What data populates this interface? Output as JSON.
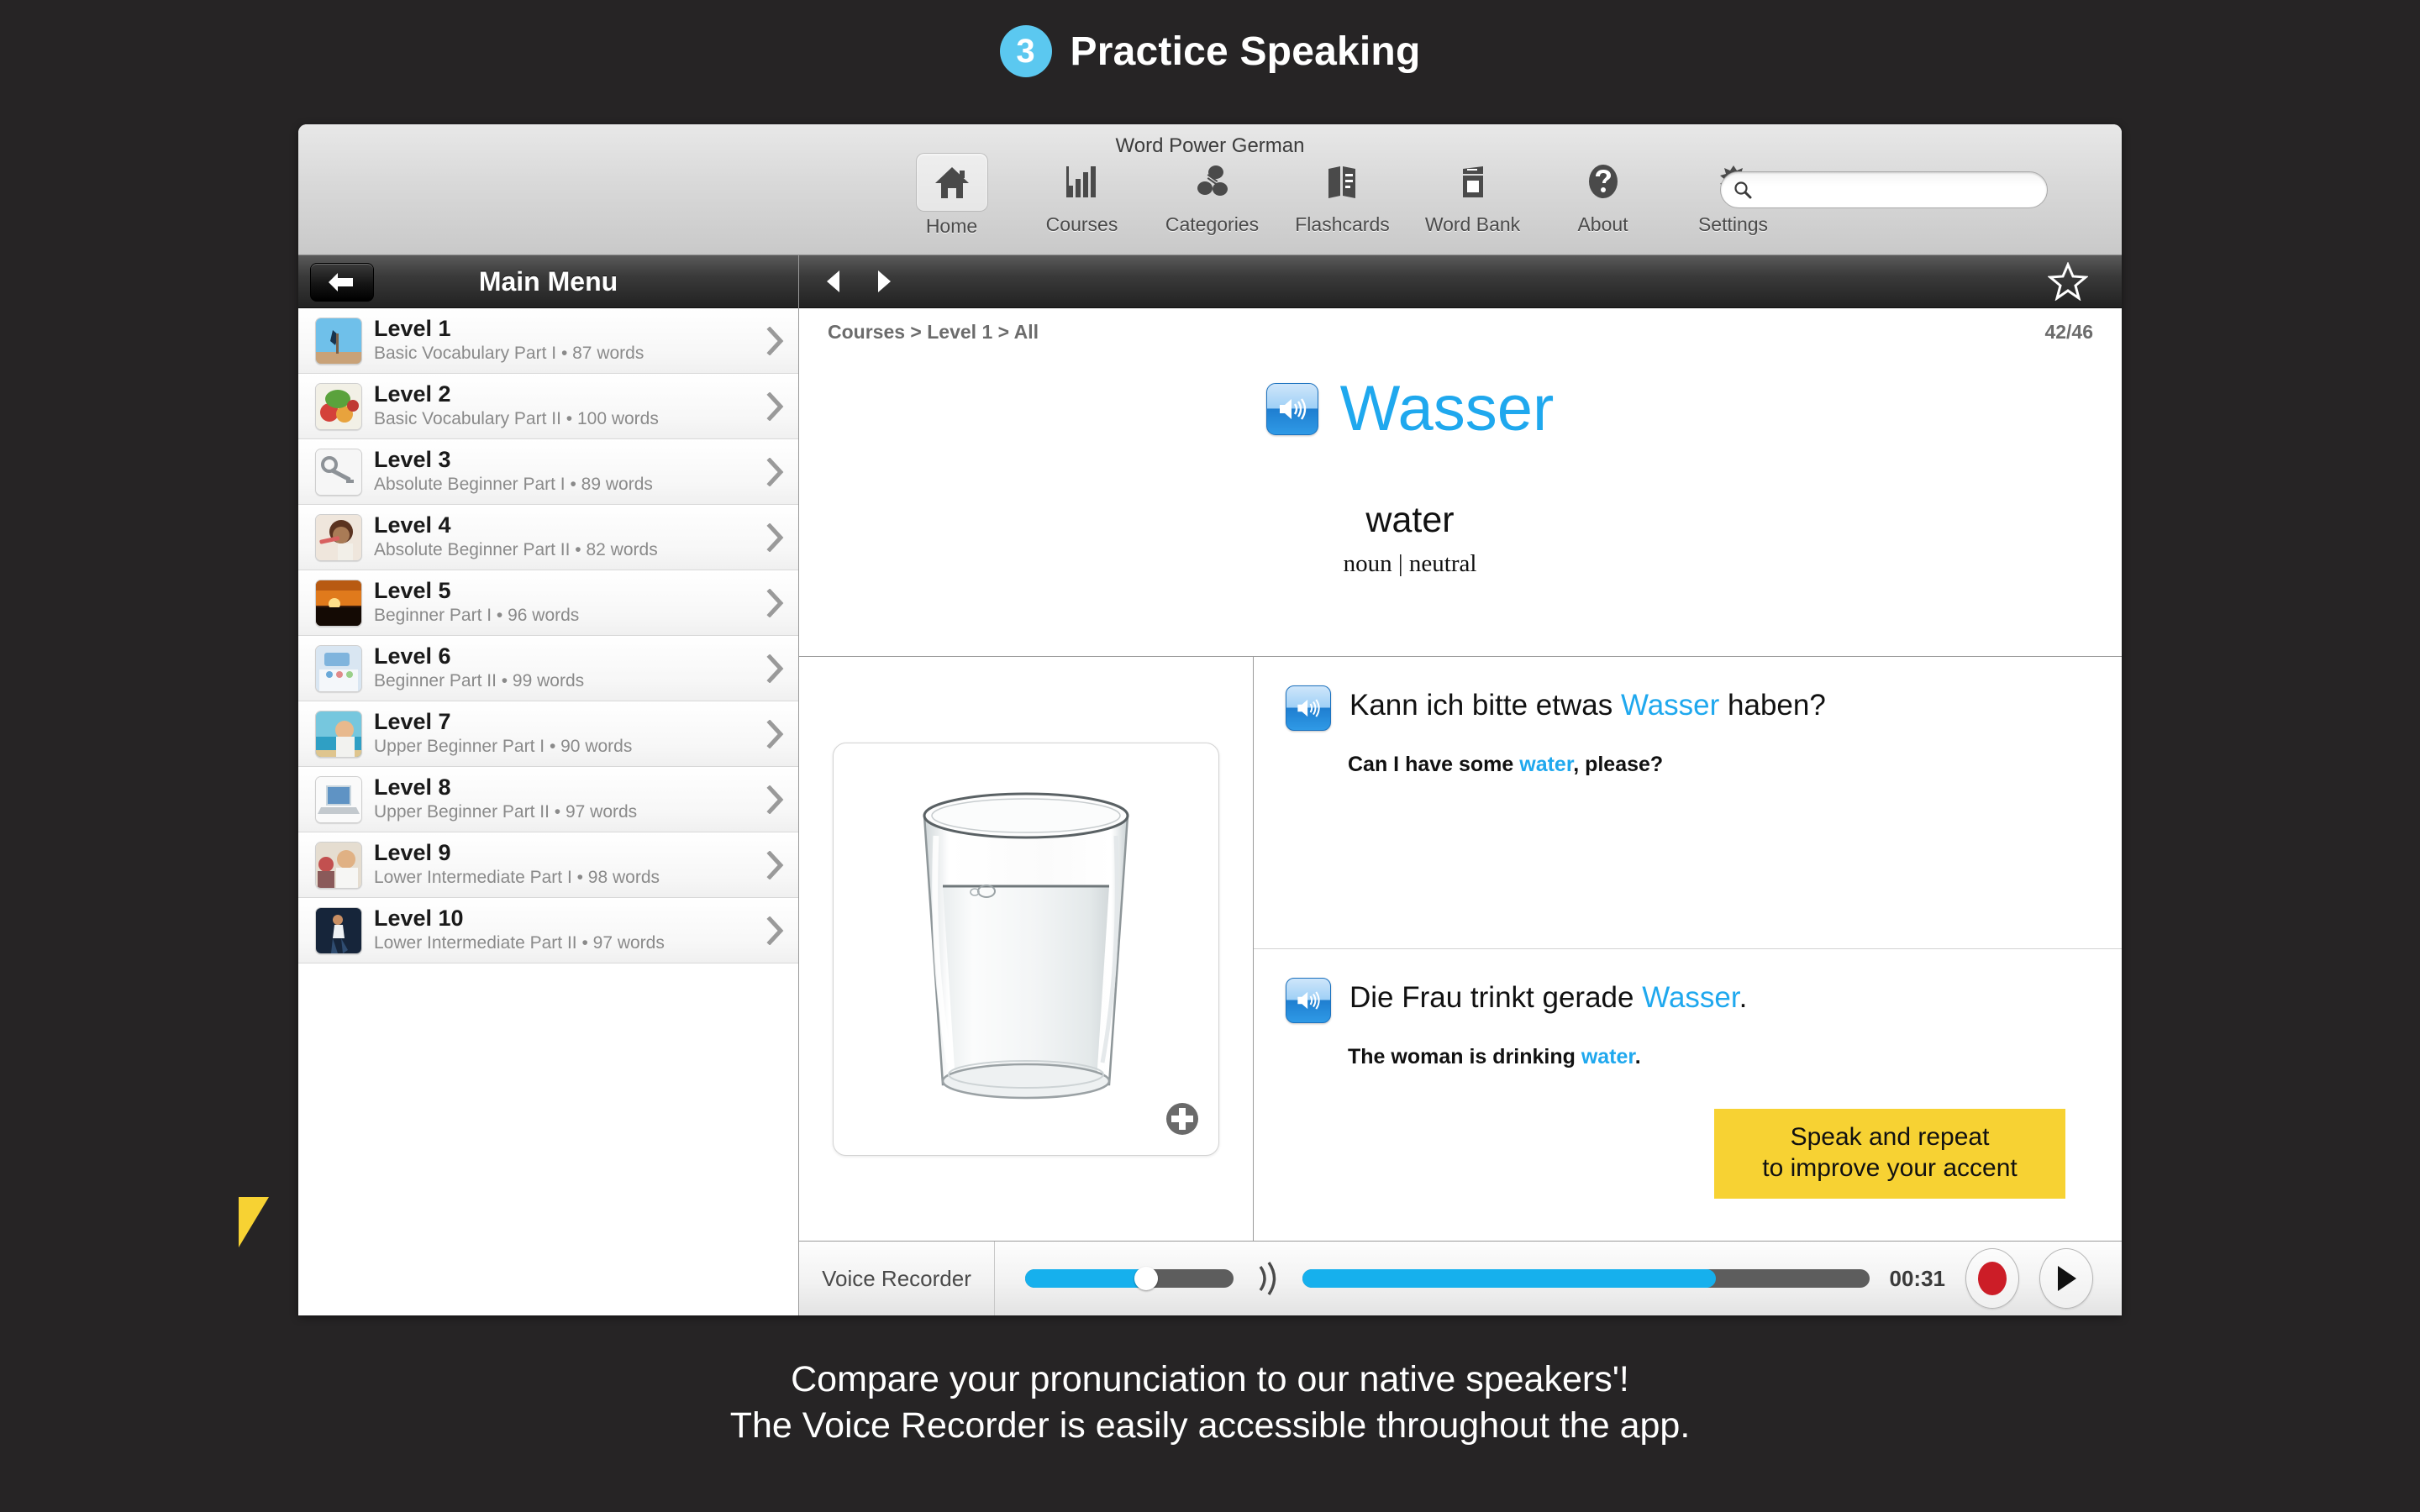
{
  "promo": {
    "step_number": "3",
    "title": "Practice Speaking",
    "caption_line1": "Compare your pronunciation to our native speakers'!",
    "caption_line2": "The Voice Recorder is easily accessible throughout the app.",
    "badge_color": "#5BC8F0"
  },
  "window": {
    "title": "Word Power German"
  },
  "toolbar": {
    "items": [
      {
        "label": "Home",
        "icon": "home-icon",
        "selected": true
      },
      {
        "label": "Courses",
        "icon": "bar-chart-icon",
        "selected": false
      },
      {
        "label": "Categories",
        "icon": "categories-icon",
        "selected": false
      },
      {
        "label": "Flashcards",
        "icon": "flashcards-icon",
        "selected": false
      },
      {
        "label": "Word Bank",
        "icon": "word-bank-icon",
        "selected": false
      },
      {
        "label": "About",
        "icon": "question-mark-icon",
        "selected": false
      },
      {
        "label": "Settings",
        "icon": "gear-icon",
        "selected": false
      }
    ],
    "search": {
      "value": "",
      "placeholder": ""
    }
  },
  "sidebar": {
    "header_title": "Main Menu",
    "back_button": "back-arrow-icon",
    "items": [
      {
        "name": "Level 1",
        "sub": "Basic Vocabulary Part I • 87 words"
      },
      {
        "name": "Level 2",
        "sub": "Basic Vocabulary Part II • 100 words"
      },
      {
        "name": "Level 3",
        "sub": "Absolute Beginner Part I • 89 words"
      },
      {
        "name": "Level 4",
        "sub": "Absolute Beginner Part II • 82 words"
      },
      {
        "name": "Level 5",
        "sub": "Beginner Part I • 96 words"
      },
      {
        "name": "Level 6",
        "sub": "Beginner Part II • 99 words"
      },
      {
        "name": "Level 7",
        "sub": "Upper Beginner Part I • 90 words"
      },
      {
        "name": "Level 8",
        "sub": "Upper Beginner Part II • 97 words"
      },
      {
        "name": "Level 9",
        "sub": "Lower Intermediate Part I • 98 words"
      },
      {
        "name": "Level 10",
        "sub": "Lower Intermediate Part II • 97 words"
      }
    ]
  },
  "detail": {
    "breadcrumb": "Courses > Level 1 > All",
    "counter": "42/46",
    "word": {
      "target": "Wasser",
      "translation": "water",
      "part_of_speech": "noun | neutral",
      "color": "#1FA8EE"
    },
    "image_alt": "glass-of-water",
    "examples": [
      {
        "target_pre": "Kann ich bitte etwas ",
        "target_hl": "Wasser",
        "target_post": " haben?",
        "trans_pre": "Can I have some ",
        "trans_hl": "water",
        "trans_post": ", please?"
      },
      {
        "target_pre": "Die Frau trinkt gerade ",
        "target_hl": "Wasser",
        "target_post": ".",
        "trans_pre": "The woman is drinking ",
        "trans_hl": "water",
        "trans_post": "."
      }
    ]
  },
  "recorder": {
    "label": "Voice Recorder",
    "volume_percent": 58,
    "progress_percent": 73,
    "time": "00:31",
    "record_button": "record-icon",
    "play_button": "play-icon",
    "record_color": "#CC1D27",
    "bar_color": "#16B0ED"
  },
  "callout": {
    "line1": "Speak and repeat",
    "line2": "to improve your accent",
    "background": "#F7D233"
  }
}
